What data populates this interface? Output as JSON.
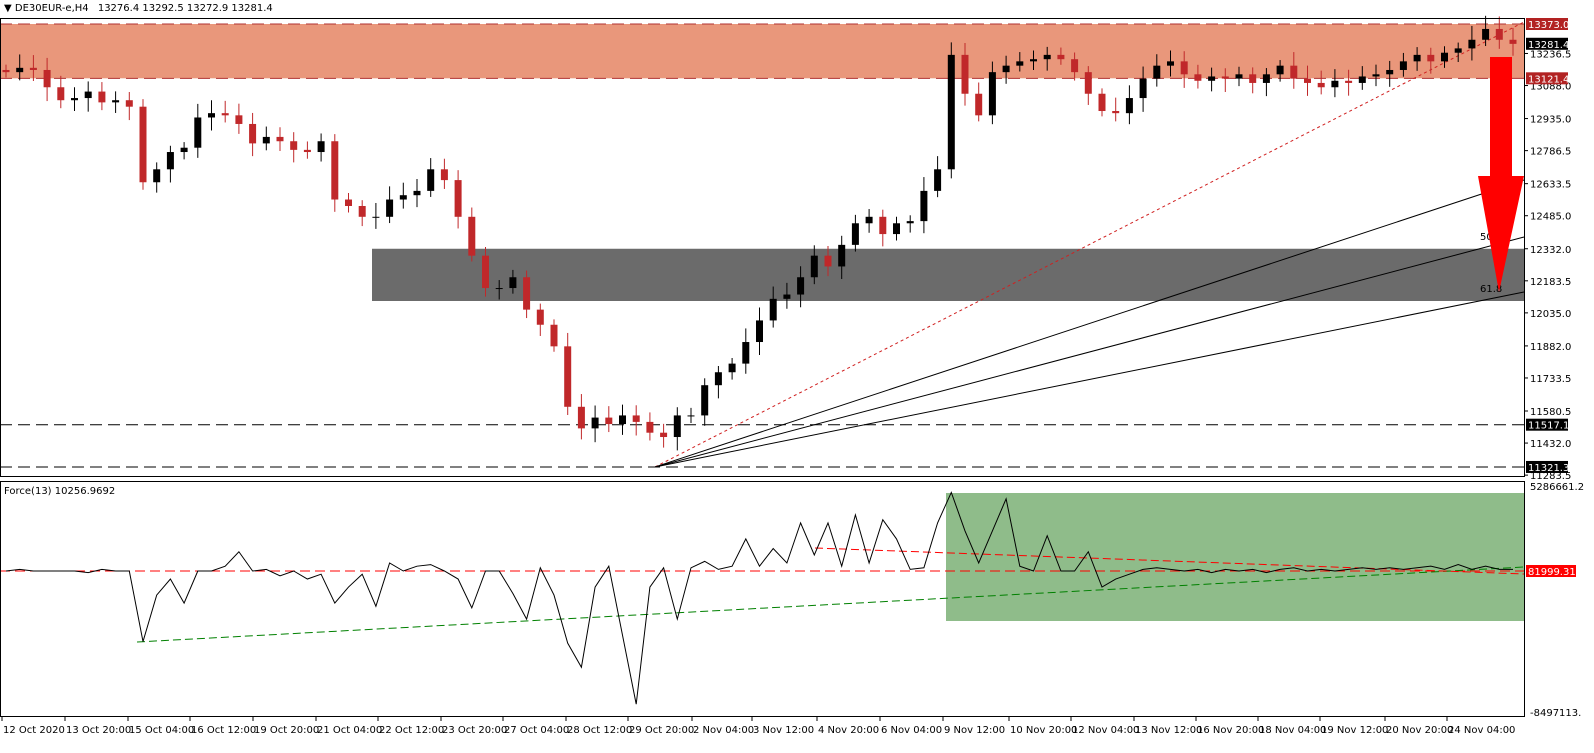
{
  "header": {
    "symbol": "DE30EUR-e,H4",
    "ohlc": "13276.4 13292.5 13272.9 13281.4"
  },
  "indicator": {
    "label": "Force(13) 10256.9692"
  },
  "colors": {
    "bull": "#000000",
    "bear": "#c0282a",
    "resistance_zone": "#e9977b",
    "support_zone": "#6b6b6b",
    "force_zone": "#8fbc8a",
    "arrow": "#ff0000"
  },
  "chart_data": [
    {
      "type": "candlestick",
      "title": "DE30EUR-e,H4",
      "ylim": [
        11283.5,
        13400
      ],
      "closes": [
        13150,
        13170,
        13160,
        13080,
        13020,
        13030,
        13060,
        13010,
        13020,
        12990,
        12640,
        12700,
        12780,
        12800,
        12940,
        12960,
        12950,
        12910,
        12820,
        12850,
        12830,
        12790,
        12780,
        12830,
        12560,
        12530,
        12480,
        12480,
        12560,
        12580,
        12600,
        12700,
        12650,
        12480,
        12300,
        12150,
        12150,
        12200,
        12050,
        11980,
        11880,
        11600,
        11500,
        11550,
        11520,
        11560,
        11530,
        11480,
        11460,
        11560,
        11560,
        11700,
        11760,
        11800,
        11900,
        12000,
        12100,
        12120,
        12200,
        12300,
        12250,
        12350,
        12450,
        12480,
        12400,
        12450,
        12460,
        12600,
        12700,
        13230,
        13050,
        12950,
        13150,
        13180,
        13200,
        13210,
        13230,
        13210,
        13150,
        13050,
        12970,
        12960,
        13030,
        13120,
        13180,
        13200,
        13140,
        13110,
        13130,
        13120,
        13140,
        13100,
        13140,
        13180,
        13120,
        13100,
        13080,
        13110,
        13100,
        13130,
        13140,
        13160,
        13200,
        13230,
        13200,
        13240,
        13260,
        13300,
        13350,
        13300,
        13281
      ],
      "y_ticks": [
        "13236.5",
        "13088.0",
        "12935.0",
        "12786.5",
        "12633.5",
        "12485.0",
        "12332.0",
        "12183.5",
        "12035.0",
        "11882.0",
        "11733.5",
        "11580.5",
        "11432.0",
        "11283.5"
      ],
      "y_tick_values": [
        13236.5,
        13088,
        12935,
        12786.5,
        12633.5,
        12485,
        12332,
        12183.5,
        12035,
        11882,
        11733.5,
        11580.5,
        11432,
        11283.5
      ],
      "price_tags": [
        {
          "text": "13373.0",
          "value": 13373,
          "style": "red"
        },
        {
          "text": "13281.4",
          "value": 13281.4,
          "style": "black"
        },
        {
          "text": "13121.4",
          "value": 13121.4,
          "style": "red"
        },
        {
          "text": "11517.1",
          "value": 11517.1,
          "style": "black"
        },
        {
          "text": "11321.3",
          "value": 11321.3,
          "style": "black"
        }
      ],
      "resistance_zone": [
        13121.4,
        13373
      ],
      "support_zone": [
        12090,
        12332
      ],
      "fib_labels": [
        "50",
        "61.8"
      ],
      "x_ticks": [
        "12 Oct 2020",
        "13 Oct 20:00",
        "15 Oct 04:00",
        "16 Oct 12:00",
        "19 Oct 20:00",
        "21 Oct 04:00",
        "22 Oct 12:00",
        "23 Oct 20:00",
        "27 Oct 04:00",
        "28 Oct 12:00",
        "29 Oct 20:00",
        "2 Nov 04:00",
        "3 Nov 12:00",
        "4 Nov 20:00",
        "6 Nov 04:00",
        "9 Nov 12:00",
        "10 Nov 20:00",
        "12 Nov 04:00",
        "13 Nov 12:00",
        "16 Nov 20:00",
        "18 Nov 04:00",
        "19 Nov 12:00",
        "20 Nov 20:00",
        "24 Nov 04:00"
      ]
    },
    {
      "type": "line",
      "title": "Force(13) 10256.9692",
      "ylim": [
        -8497113,
        5286661
      ],
      "y_ticks": [
        "5286661.2",
        "-8497113."
      ],
      "zero_tag": "81999.31",
      "values_millions": [
        0,
        0.1,
        0,
        0,
        0,
        0,
        -0.1,
        0.1,
        0,
        0,
        -4.4,
        -1.5,
        -0.5,
        -2.0,
        0,
        0,
        0.3,
        1.2,
        0,
        0.1,
        -0.3,
        0,
        -0.5,
        -0.2,
        -2.0,
        -1.0,
        -0.2,
        -2.2,
        0.5,
        0,
        0.3,
        0.4,
        0,
        -0.5,
        -2.3,
        0,
        0,
        -1.4,
        -3.0,
        0.2,
        -1.5,
        -4.5,
        -6.0,
        -1.0,
        0.3,
        -4.0,
        -8.3,
        -1.0,
        0.2,
        -3.0,
        0.2,
        0.6,
        0.1,
        0.3,
        2.0,
        0.3,
        1.4,
        0.5,
        3.0,
        1.0,
        3.0,
        0.3,
        3.5,
        0.5,
        3.2,
        2.0,
        0.1,
        0.2,
        3.0,
        4.9,
        2.5,
        0.5,
        2.5,
        4.5,
        0.3,
        0,
        2.2,
        0,
        0,
        1.2,
        -1.0,
        -0.5,
        -0.2,
        0.1,
        0.2,
        0.1,
        0,
        0.1,
        -0.1,
        0.1,
        0,
        0.1,
        -0.1,
        0.1,
        0.2,
        0,
        0.1,
        0,
        0.1,
        0.2,
        0.1,
        0.2,
        0.1,
        0.2,
        0.3,
        0.1,
        0.4,
        0.1,
        0.3,
        0.1,
        0.1
      ]
    }
  ]
}
